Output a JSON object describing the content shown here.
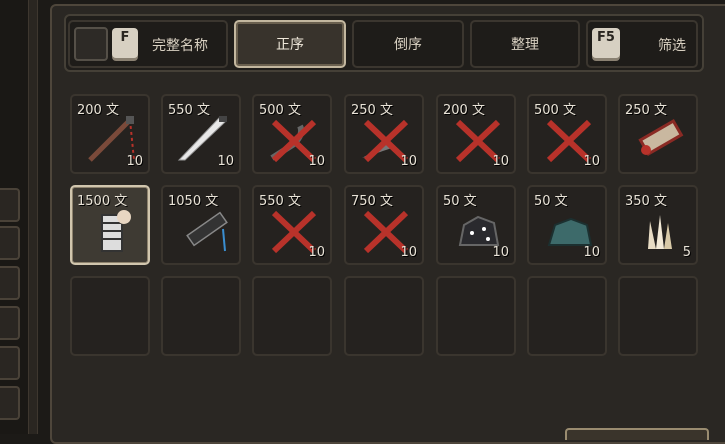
{
  "toolbar": {
    "full_name_key": "F",
    "full_name_label": "完整名称",
    "sort_asc_label": "正序",
    "sort_desc_label": "倒序",
    "organize_label": "整理",
    "filter_key": "F5",
    "filter_label": "筛选"
  },
  "colors": {
    "panel_bg": "#2a2723",
    "slot_border": "#3a352e",
    "selected_border": "#d1c6ae",
    "text": "#e9e3d7",
    "red_x": "#b8322a"
  },
  "inventory": {
    "row1": [
      {
        "price": "200 文",
        "count": "10",
        "icon": "whip-icon"
      },
      {
        "price": "550 文",
        "count": "10",
        "icon": "sword-icon"
      },
      {
        "price": "500 文",
        "count": "10",
        "icon": "sickle-icon"
      },
      {
        "price": "250 文",
        "count": "10",
        "icon": "axe-icon"
      },
      {
        "price": "200 文",
        "count": "10",
        "icon": "crossed-item-icon"
      },
      {
        "price": "500 文",
        "count": "10",
        "icon": "crossed-item-icon"
      },
      {
        "price": "250 文",
        "count": "",
        "icon": "scroll-icon"
      }
    ],
    "row2": [
      {
        "price": "1500 文",
        "count": "",
        "icon": "bone-scroll-icon"
      },
      {
        "price": "1050 文",
        "count": "",
        "icon": "dark-blade-icon"
      },
      {
        "price": "550 文",
        "count": "10",
        "icon": "hammer-icon"
      },
      {
        "price": "750 文",
        "count": "10",
        "icon": "crossbow-icon"
      },
      {
        "price": "50 文",
        "count": "10",
        "icon": "coal-ore-icon"
      },
      {
        "price": "50 文",
        "count": "10",
        "icon": "teal-ore-icon"
      },
      {
        "price": "350 文",
        "count": "5",
        "icon": "crystal-icon"
      }
    ]
  }
}
